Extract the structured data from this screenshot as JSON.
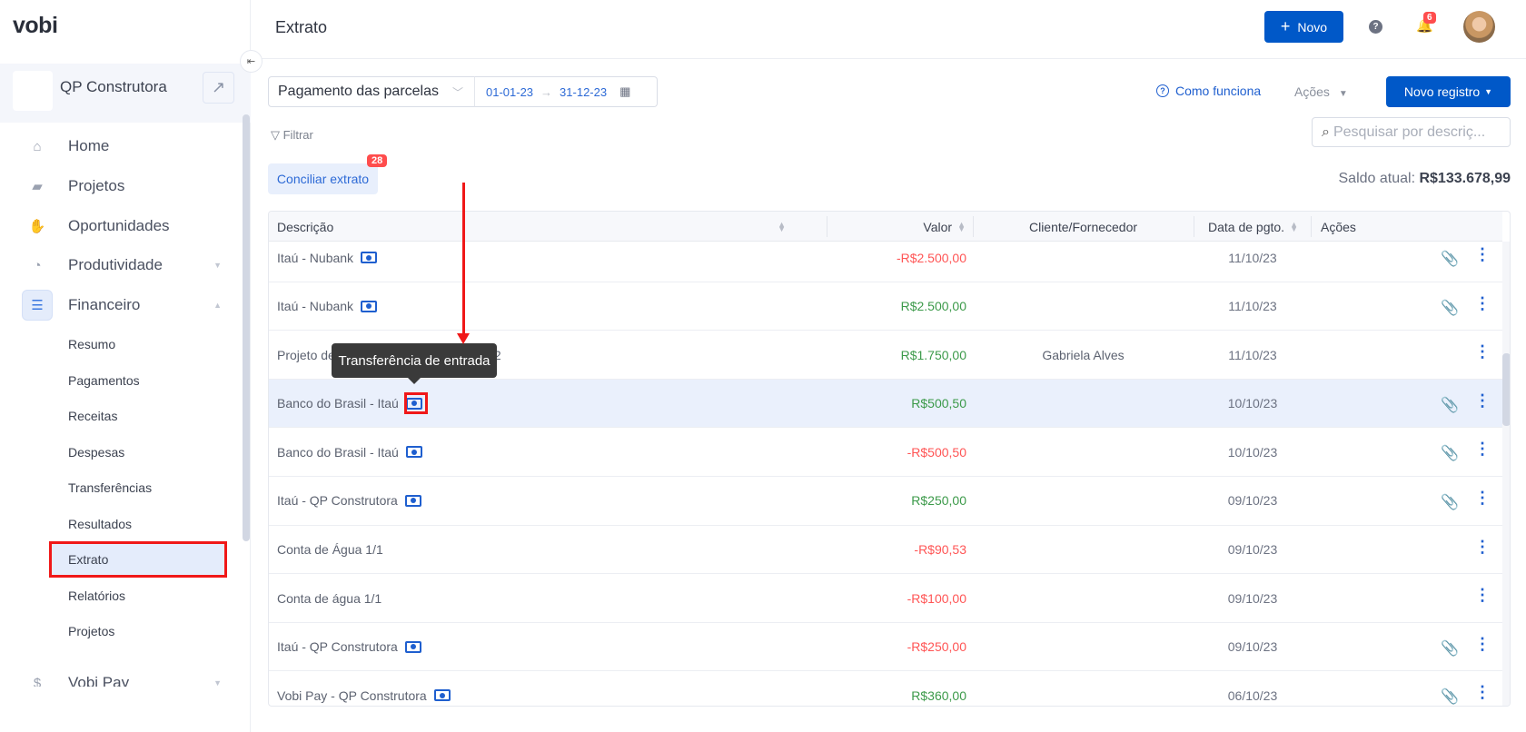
{
  "app": {
    "logo": "vobi",
    "page_title": "Extrato"
  },
  "company": {
    "name": "QP Construtora"
  },
  "header": {
    "new_button": "Novo",
    "notifications_count": "6"
  },
  "sidebar": {
    "items": [
      {
        "label": "Home",
        "icon": "home-icon"
      },
      {
        "label": "Projetos",
        "icon": "folder-icon"
      },
      {
        "label": "Oportunidades",
        "icon": "handshake-icon"
      },
      {
        "label": "Produtividade",
        "icon": "gauge-icon"
      },
      {
        "label": "Financeiro",
        "icon": "coins-icon"
      },
      {
        "label": "Vobi Pay",
        "icon": "dollar-icon"
      }
    ],
    "financeiro_sub": [
      "Resumo",
      "Pagamentos",
      "Receitas",
      "Despesas",
      "Transferências",
      "Resultados",
      "Extrato",
      "Relatórios",
      "Projetos"
    ],
    "active": "Extrato"
  },
  "toolbar": {
    "select_value": "Pagamento das parcelas",
    "date_start": "01-01-23",
    "date_end": "31-12-23",
    "how_it_works": "Como funciona",
    "actions": "Ações",
    "new_record": "Novo registro",
    "filter": "Filtrar",
    "search_placeholder": "Pesquisar por descriç...",
    "reconcile": "Conciliar extrato",
    "reconcile_count": "28",
    "balance_label": "Saldo atual:",
    "balance_value": "R$133.678,99"
  },
  "table": {
    "columns": [
      "Descrição",
      "Valor",
      "Cliente/Fornecedor",
      "Data de pgto.",
      "Ações"
    ],
    "rows": [
      {
        "desc": "Itaú - Nubank",
        "transfer": true,
        "value": "-R$2.500,00",
        "sign": "neg",
        "client": "",
        "date": "11/10/23",
        "attach": true
      },
      {
        "desc": "Itaú - Nubank",
        "transfer": true,
        "value": "R$2.500,00",
        "sign": "pos",
        "client": "",
        "date": "11/10/23",
        "attach": true
      },
      {
        "desc": "Projeto de Interiores - Sala Gabriela 1/2",
        "transfer": false,
        "value": "R$1.750,00",
        "sign": "pos",
        "client": "Gabriela Alves",
        "date": "11/10/23",
        "attach": false
      },
      {
        "desc": "Banco do Brasil - Itaú",
        "transfer": true,
        "value": "R$500,50",
        "sign": "pos",
        "client": "",
        "date": "10/10/23",
        "attach": true,
        "highlight": true
      },
      {
        "desc": "Banco do Brasil - Itaú",
        "transfer": true,
        "value": "-R$500,50",
        "sign": "neg",
        "client": "",
        "date": "10/10/23",
        "attach": true
      },
      {
        "desc": "Itaú - QP Construtora",
        "transfer": true,
        "value": "R$250,00",
        "sign": "pos",
        "client": "",
        "date": "09/10/23",
        "attach": true
      },
      {
        "desc": "Conta de Água 1/1",
        "transfer": false,
        "value": "-R$90,53",
        "sign": "neg",
        "client": "",
        "date": "09/10/23",
        "attach": false
      },
      {
        "desc": "Conta de água 1/1",
        "transfer": false,
        "value": "-R$100,00",
        "sign": "neg",
        "client": "",
        "date": "09/10/23",
        "attach": false
      },
      {
        "desc": "Itaú - QP Construtora",
        "transfer": true,
        "value": "-R$250,00",
        "sign": "neg",
        "client": "",
        "date": "09/10/23",
        "attach": true
      },
      {
        "desc": "Vobi Pay - QP Construtora",
        "transfer": true,
        "value": "R$360,00",
        "sign": "pos",
        "client": "",
        "date": "06/10/23",
        "attach": true
      }
    ]
  },
  "tooltip": {
    "text": "Transferência de entrada"
  },
  "colors": {
    "primary": "#0058c8",
    "positive": "#3c9a4a",
    "negative": "#ff5555",
    "annotation": "#f01818"
  }
}
